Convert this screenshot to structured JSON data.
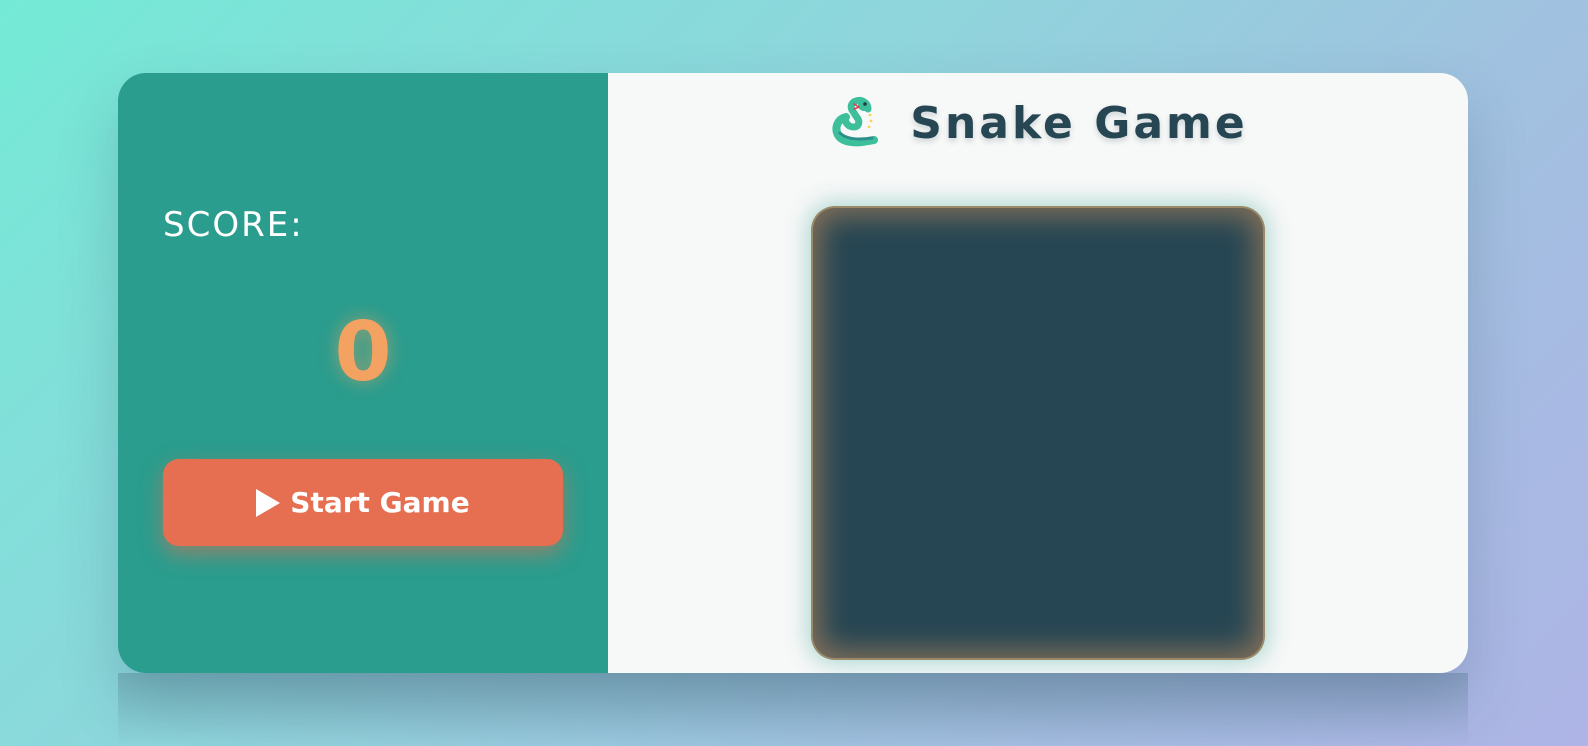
{
  "sidebar": {
    "score_label": "SCORE:",
    "score_value": "0",
    "start_button_label": "Start Game",
    "start_button_icon": "play-icon"
  },
  "header": {
    "icon": "snake-icon",
    "title": "Snake Game"
  },
  "colors": {
    "sidebar": "#2a9d8e",
    "accent": "#f4a261",
    "button": "#e76f51",
    "board": "#264653",
    "panel": "#f7f8f8"
  }
}
